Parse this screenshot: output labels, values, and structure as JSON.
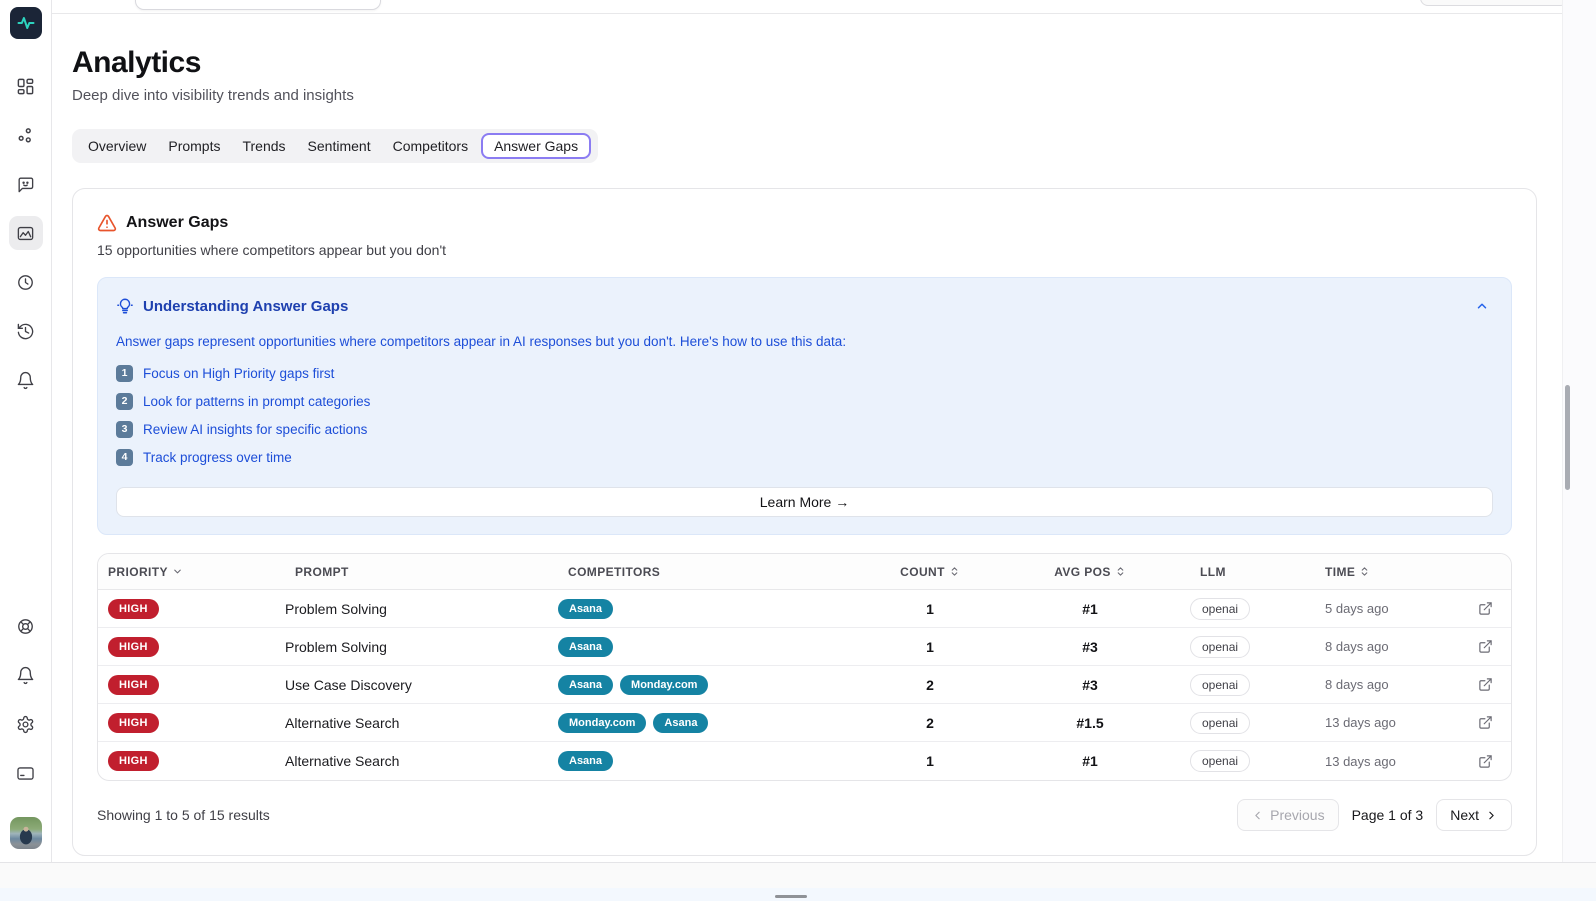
{
  "header": {
    "title": "Analytics",
    "subtitle": "Deep dive into visibility trends and insights"
  },
  "tabs": {
    "items": [
      "Overview",
      "Prompts",
      "Trends",
      "Sentiment",
      "Competitors",
      "Answer Gaps"
    ],
    "active": "Answer Gaps"
  },
  "panel": {
    "title": "Answer Gaps",
    "subtitle": "15 opportunities where competitors appear but you don't",
    "info": {
      "title": "Understanding Answer Gaps",
      "intro": "Answer gaps represent opportunities where competitors appear in AI responses but you don't. Here's how to use this data:",
      "steps": [
        {
          "num": "1",
          "text": "Focus on High Priority gaps first"
        },
        {
          "num": "2",
          "text": "Look for patterns in prompt categories"
        },
        {
          "num": "3",
          "text": "Review AI insights for specific actions"
        },
        {
          "num": "4",
          "text": "Track progress over time"
        }
      ],
      "learn_more": "Learn More →"
    },
    "table": {
      "columns": [
        {
          "label": "PRIORITY",
          "sort": "desc",
          "align": "left"
        },
        {
          "label": "PROMPT",
          "sort": "none",
          "align": "left"
        },
        {
          "label": "COMPETITORS",
          "sort": "none",
          "align": "left"
        },
        {
          "label": "COUNT",
          "sort": "both",
          "align": "center"
        },
        {
          "label": "AVG POS",
          "sort": "both",
          "align": "center"
        },
        {
          "label": "LLM",
          "sort": "none",
          "align": "left"
        },
        {
          "label": "TIME",
          "sort": "both",
          "align": "left"
        },
        {
          "label": "",
          "sort": "none",
          "align": "center"
        }
      ],
      "rows": [
        {
          "priority": "HIGH",
          "prompt": "Problem Solving",
          "competitors": [
            "Asana"
          ],
          "count": "1",
          "avg_pos": "#1",
          "llm": "openai",
          "time": "5 days ago"
        },
        {
          "priority": "HIGH",
          "prompt": "Problem Solving",
          "competitors": [
            "Asana"
          ],
          "count": "1",
          "avg_pos": "#3",
          "llm": "openai",
          "time": "8 days ago"
        },
        {
          "priority": "HIGH",
          "prompt": "Use Case Discovery",
          "competitors": [
            "Asana",
            "Monday.com"
          ],
          "count": "2",
          "avg_pos": "#3",
          "llm": "openai",
          "time": "8 days ago"
        },
        {
          "priority": "HIGH",
          "prompt": "Alternative Search",
          "competitors": [
            "Monday.com",
            "Asana"
          ],
          "count": "2",
          "avg_pos": "#1.5",
          "llm": "openai",
          "time": "13 days ago"
        },
        {
          "priority": "HIGH",
          "prompt": "Alternative Search",
          "competitors": [
            "Asana"
          ],
          "count": "1",
          "avg_pos": "#1",
          "llm": "openai",
          "time": "13 days ago"
        }
      ]
    },
    "footer": {
      "showing": "Showing 1 to 5 of 15 results",
      "previous": "Previous",
      "page": "Page 1 of 3",
      "next": "Next"
    }
  },
  "colors": {
    "accent_purple": "#8b7cf2",
    "priority_high_red": "#c11f2e",
    "competitor_teal": "#1583a3",
    "info_bg_blue": "#ebf2fc",
    "info_text_blue": "#1d4ed8",
    "step_badge_slate": "#5c7b9a",
    "warning_orange": "#e8542c",
    "logo_navy": "#1b2537",
    "logo_teal": "#2dd4bf"
  }
}
